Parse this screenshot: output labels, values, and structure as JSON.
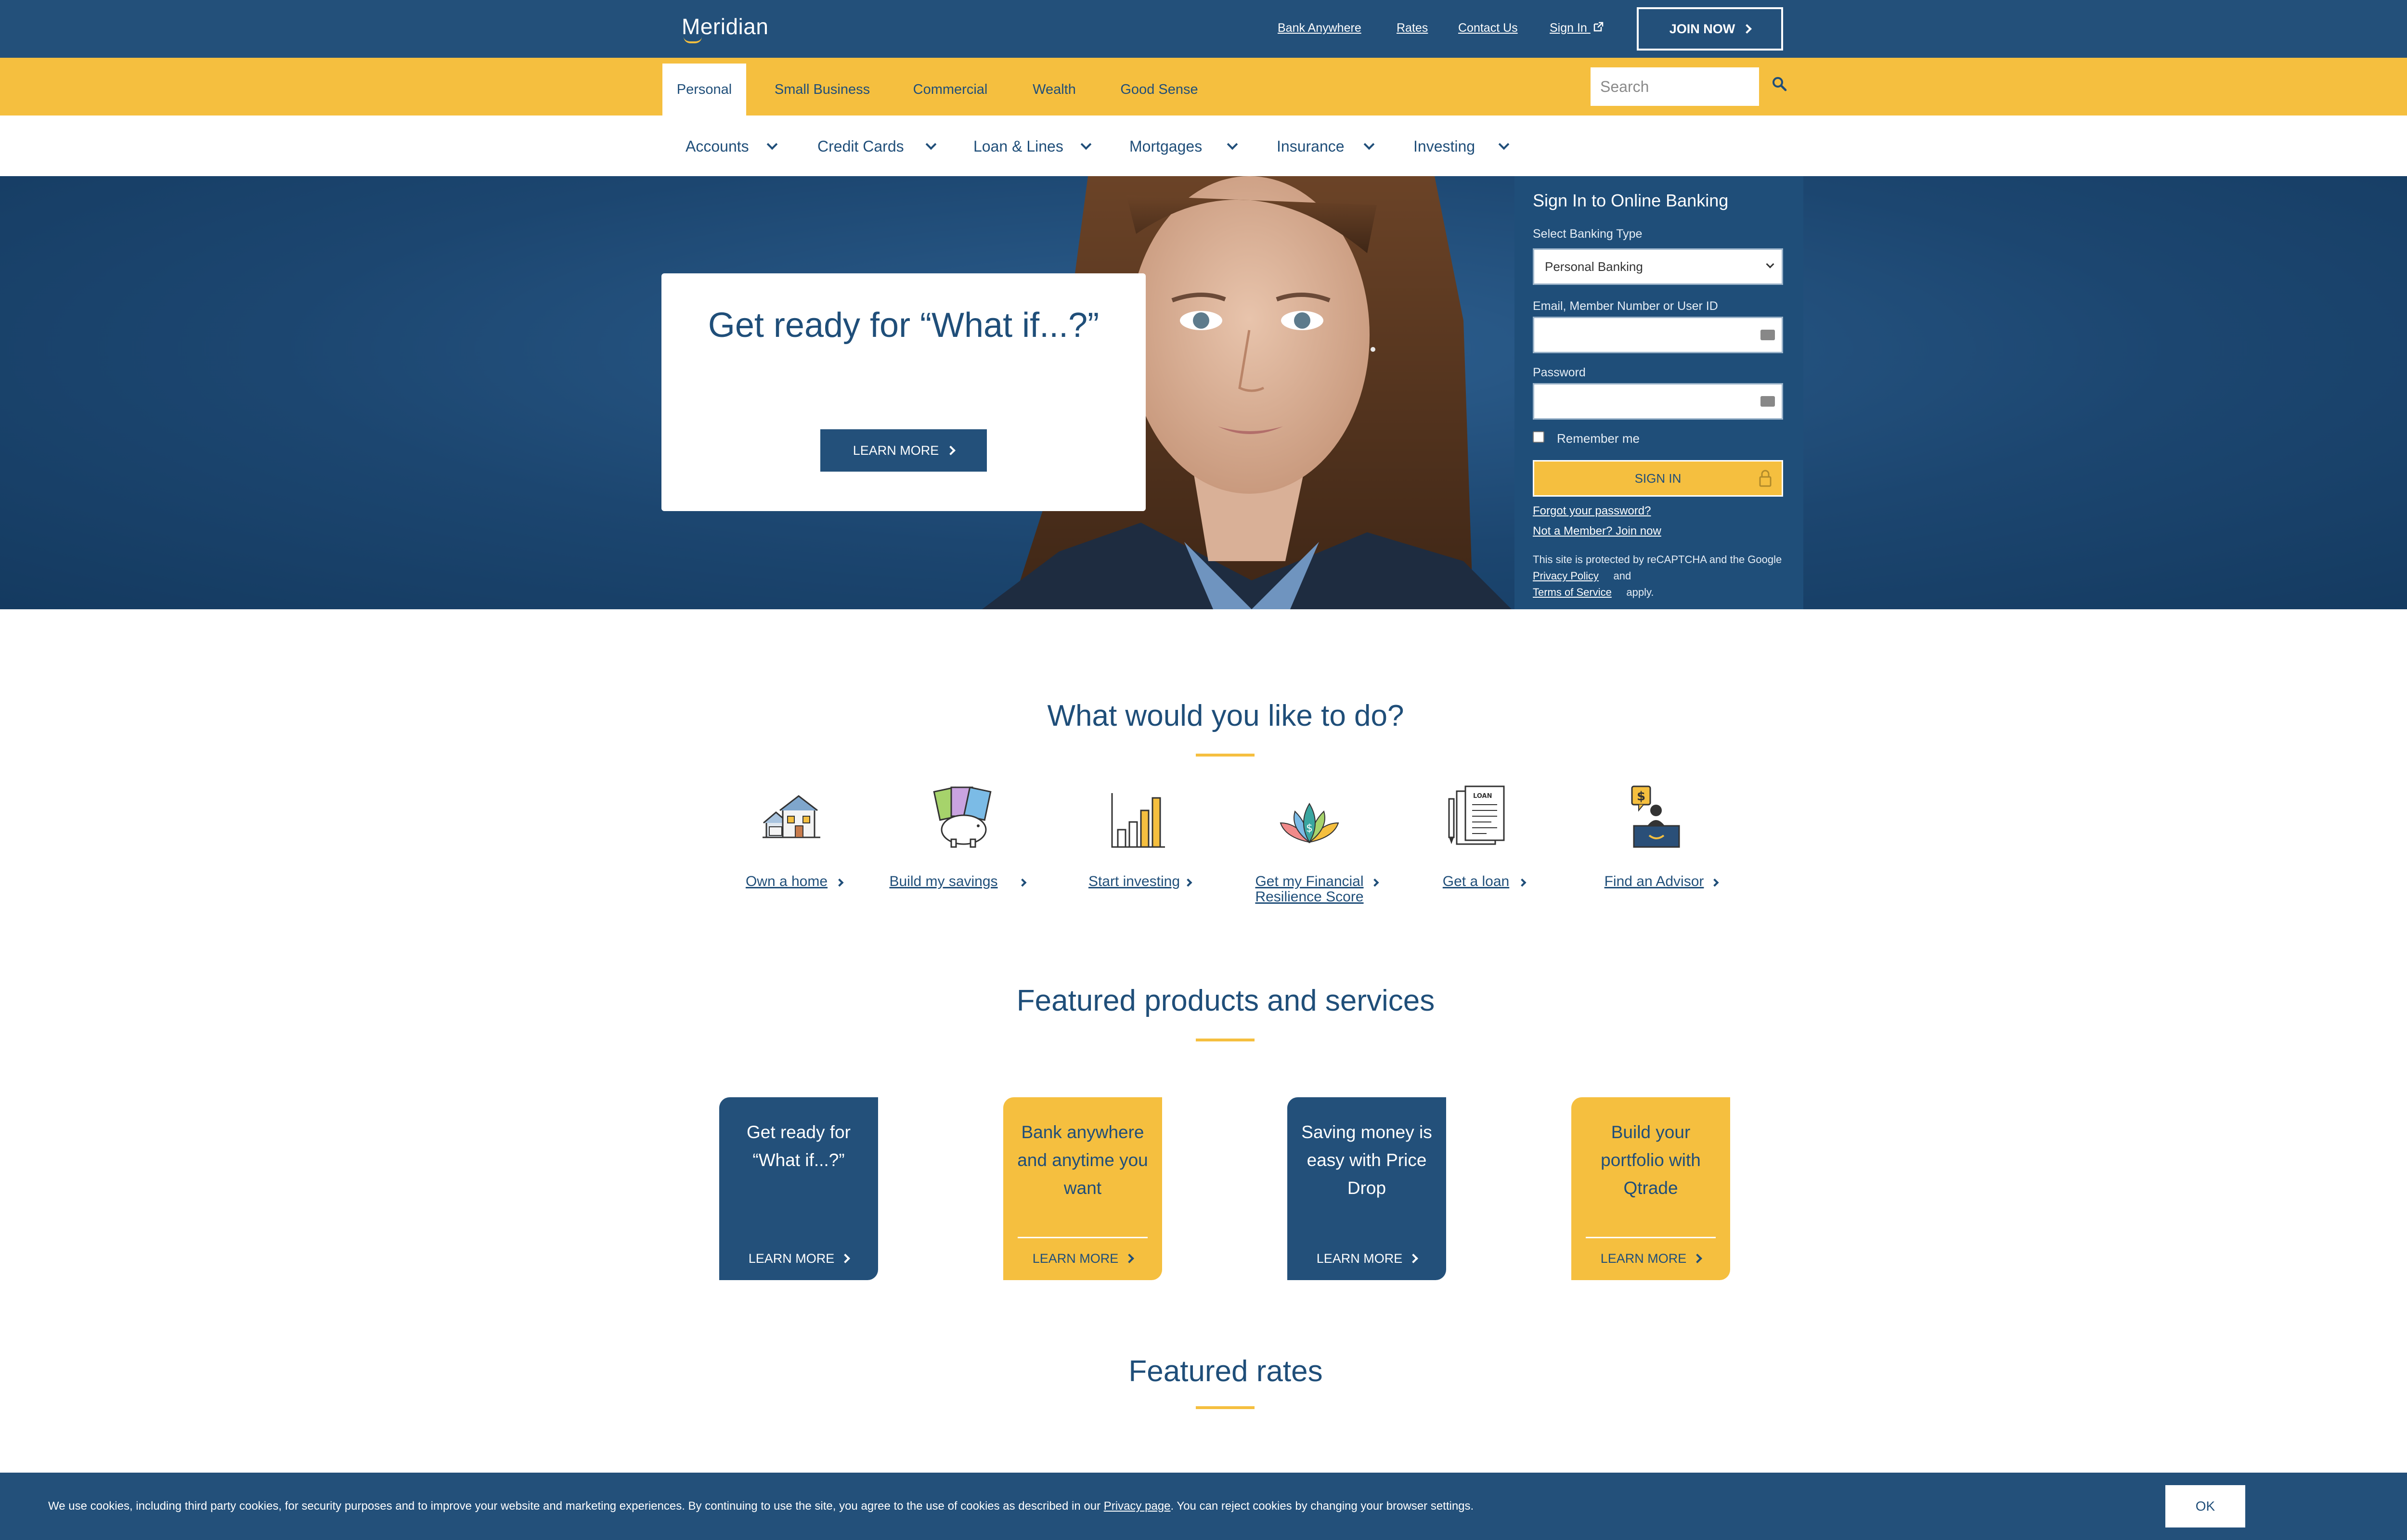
{
  "brand": {
    "name": "Meridian",
    "navy": "#23507a",
    "gold": "#f5bf3f"
  },
  "topnav": {
    "links": [
      "Bank Anywhere",
      "Rates",
      "Contact Us",
      "Sign In"
    ],
    "join_label": "JOIN NOW"
  },
  "segments": {
    "tabs": [
      "Personal",
      "Small Business",
      "Commercial",
      "Wealth",
      "Good Sense"
    ],
    "active": "Personal",
    "search_placeholder": "Search"
  },
  "product_nav": [
    "Accounts",
    "Credit Cards",
    "Loan & Lines",
    "Mortgages",
    "Insurance",
    "Investing"
  ],
  "hero": {
    "title": "Get ready for “What if...?”",
    "cta": "LEARN MORE"
  },
  "signin": {
    "title": "Sign In to Online Banking",
    "type_label": "Select Banking Type",
    "type_value": "Personal Banking",
    "user_label": "Email, Member Number or User ID",
    "password_label": "Password",
    "remember_label": "Remember me",
    "button": "SIGN IN",
    "forgot": "Forgot your password?",
    "not_member": "Not a Member? Join now",
    "fine_pre": "This site is protected by reCAPTCHA and the Google",
    "fine_privacy": "Privacy Policy",
    "fine_and": "and",
    "fine_terms": "Terms of Service",
    "fine_post": "apply."
  },
  "actions": {
    "heading": "What would you like to do?",
    "items": [
      {
        "label": "Own a home",
        "icon": "house-icon"
      },
      {
        "label": "Build my savings",
        "icon": "piggy-bank-icon"
      },
      {
        "label": "Start investing",
        "icon": "bar-chart-icon"
      },
      {
        "label": "Get my Financial Resilience Score",
        "icon": "lotus-icon"
      },
      {
        "label": "Get a loan",
        "icon": "loan-document-icon"
      },
      {
        "label": "Find an Advisor",
        "icon": "advisor-desk-icon"
      }
    ]
  },
  "featured": {
    "heading": "Featured products and services",
    "cards": [
      {
        "text": "Get ready for “What if...?”",
        "cta": "LEARN MORE",
        "style": "navy"
      },
      {
        "text": "Bank anywhere and anytime you want",
        "cta": "LEARN MORE",
        "style": "gold"
      },
      {
        "text": "Saving money is easy with Price Drop",
        "cta": "LEARN MORE",
        "style": "navy"
      },
      {
        "text": "Build your portfolio with Qtrade",
        "cta": "LEARN MORE",
        "style": "gold"
      }
    ]
  },
  "rates": {
    "heading": "Featured rates"
  },
  "cookie": {
    "text_pre": "We use cookies, including third party cookies, for security purposes and to improve your website and marketing experiences. By continuing to use the site, you agree to the use of cookies as described in our",
    "link": "Privacy page",
    "text_post": ". You can reject cookies by changing your browser settings.",
    "ok": "OK"
  }
}
